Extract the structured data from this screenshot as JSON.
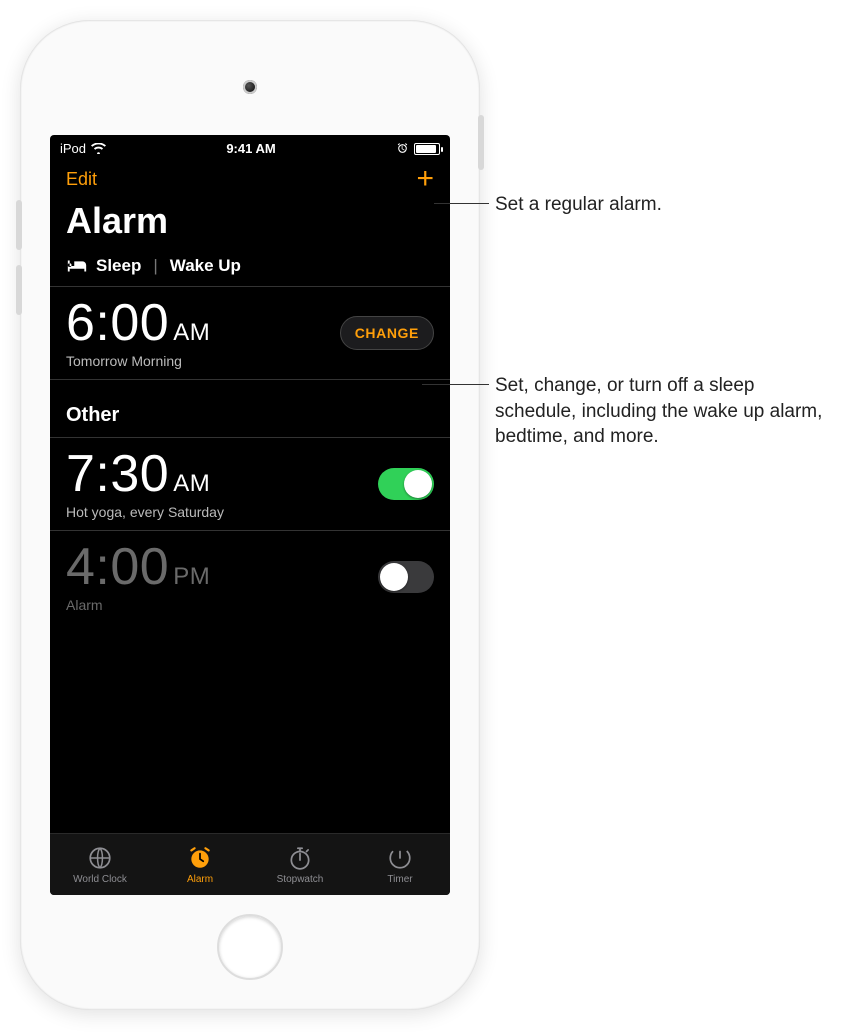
{
  "statusbar": {
    "carrier": "iPod",
    "time": "9:41 AM"
  },
  "navbar": {
    "edit": "Edit",
    "add_glyph": "+"
  },
  "title": "Alarm",
  "sleep_section": {
    "label_sleep": "Sleep",
    "label_wake": "Wake Up",
    "time": "6:00",
    "ampm": "AM",
    "subtitle": "Tomorrow Morning",
    "change_label": "CHANGE"
  },
  "other_section": {
    "header": "Other",
    "alarms": [
      {
        "time": "7:30",
        "ampm": "AM",
        "label": "Hot yoga, every Saturday",
        "on": true
      },
      {
        "time": "4:00",
        "ampm": "PM",
        "label": "Alarm",
        "on": false
      }
    ]
  },
  "tabs": {
    "world_clock": "World Clock",
    "alarm": "Alarm",
    "stopwatch": "Stopwatch",
    "timer": "Timer",
    "active": "alarm"
  },
  "callouts": {
    "add": "Set a regular alarm.",
    "change": "Set, change, or turn off a sleep schedule, including the wake up alarm, bedtime, and more."
  },
  "colors": {
    "accent": "#ff9f0a",
    "toggle_on": "#30d158"
  }
}
